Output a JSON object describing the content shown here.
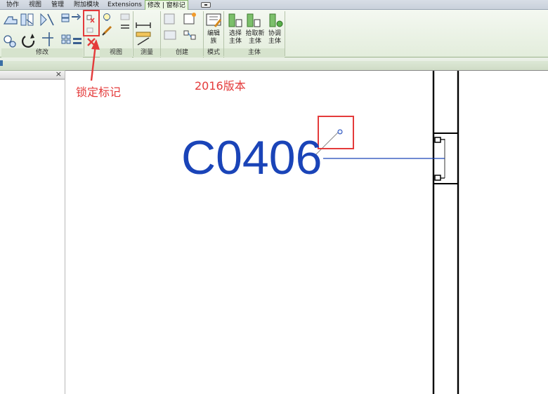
{
  "tabs": [
    {
      "label": "协作",
      "active": false
    },
    {
      "label": "视图",
      "active": false
    },
    {
      "label": "管理",
      "active": false
    },
    {
      "label": "附加模块",
      "active": false
    },
    {
      "label": "Extensions",
      "active": false
    },
    {
      "label": "修改 | 窗标记",
      "active": true
    }
  ],
  "ribbon": {
    "panels": {
      "modify": "修改",
      "view": "视图",
      "measure": "测量",
      "create": "创建",
      "mode": "模式",
      "host": "主体"
    },
    "buttons": {
      "edit_family": "编辑\n族",
      "pick_host": "选择\n主体",
      "pick_new_host": "拾取新\n主体",
      "reconcile_host": "协调\n主体"
    }
  },
  "annotations": {
    "lock_tag": "锁定标记",
    "version": "2016版本"
  },
  "canvas": {
    "tag_text": "C0406"
  },
  "colors": {
    "annotation_red": "#e43b3b",
    "tag_blue": "#1a44b8",
    "ribbon_green": "#e3eddc"
  }
}
